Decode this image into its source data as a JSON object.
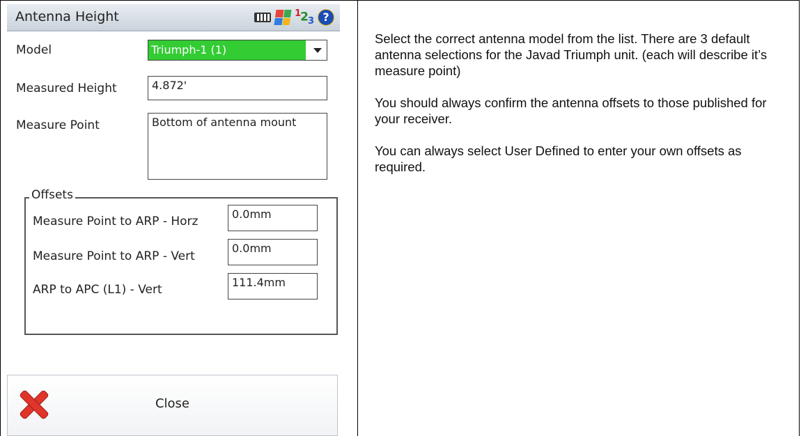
{
  "window": {
    "title": "Antenna Height"
  },
  "tray": {
    "icons": [
      "keyboard-icon",
      "windows-flag-icon",
      "input-mode-icon",
      "help-icon"
    ],
    "input_mode": {
      "a": "1",
      "b": "2",
      "c": "3"
    },
    "help": "?"
  },
  "form": {
    "model": {
      "label": "Model",
      "value": "Triumph-1 (1)"
    },
    "measured_height": {
      "label": "Measured Height",
      "value": "4.872'"
    },
    "measure_point": {
      "label": "Measure Point",
      "value": "Bottom of antenna mount"
    }
  },
  "offsets": {
    "legend": "Offsets",
    "rows": [
      {
        "label": "Measure Point to ARP - Horz",
        "value": "0.0mm"
      },
      {
        "label": "Measure Point to ARP - Vert",
        "value": "0.0mm"
      },
      {
        "label": "ARP to APC (L1) - Vert",
        "value": "111.4mm"
      }
    ]
  },
  "close_button": {
    "label": "Close"
  },
  "instructions": [
    "Select the correct antenna model from the list. There are 3 default antenna selections for the Javad Triumph unit. (each will describe it’s measure point)",
    "You should always confirm the antenna offsets to those published for your receiver.",
    "You can always select User Defined to enter your own offsets as required."
  ],
  "colors": {
    "selected_model_bg": "#33cc33",
    "close_icon": "#e0352b"
  }
}
